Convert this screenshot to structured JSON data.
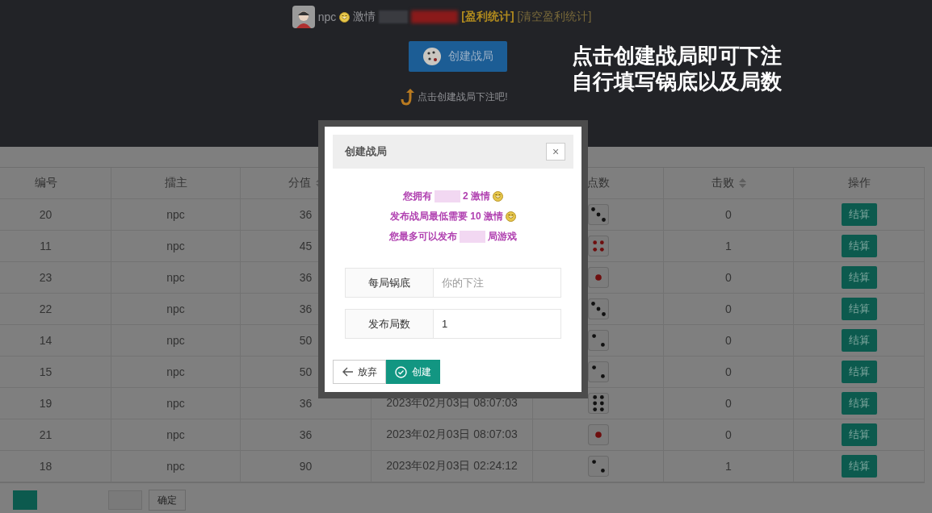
{
  "header": {
    "user": "npc",
    "currency_label": "激情",
    "profit_link": "[盈利统计]",
    "clear_link": "[清空盈利统计]",
    "create_button": "创建战局",
    "hint": "点击创建战局下注吧!"
  },
  "annotation": [
    "点击创建战局即可下注",
    "自行填写锅底以及局数"
  ],
  "table": {
    "columns": [
      {
        "label": "编号",
        "sortable": false
      },
      {
        "label": "擂主",
        "sortable": false
      },
      {
        "label": "分值",
        "sortable": true
      },
      {
        "label": "点数",
        "sortable": false
      },
      {
        "label": "击败",
        "sortable": true
      },
      {
        "label": "操作",
        "sortable": false
      }
    ],
    "rows": [
      {
        "id": "20",
        "host": "npc",
        "score": "36",
        "kind": "three",
        "defeated": "0",
        "action": "结算"
      },
      {
        "id": "11",
        "host": "npc",
        "score": "45",
        "kind": "four",
        "defeated": "1",
        "action": "结算"
      },
      {
        "id": "23",
        "host": "npc",
        "score": "36",
        "kind": "one",
        "defeated": "0",
        "action": "结算"
      },
      {
        "id": "22",
        "host": "npc",
        "score": "36",
        "kind": "three",
        "defeated": "0",
        "action": "结算"
      },
      {
        "id": "14",
        "host": "npc",
        "score": "50",
        "kind": "two",
        "defeated": "0",
        "action": "结算"
      },
      {
        "id": "15",
        "host": "npc",
        "score": "50",
        "kind": "two",
        "defeated": "0",
        "action": "结算"
      },
      {
        "id": "19",
        "host": "npc",
        "score": "36",
        "time": "2023年02月03日 08:07:03",
        "kind": "six",
        "defeated": "0",
        "action": "结算"
      },
      {
        "id": "21",
        "host": "npc",
        "score": "36",
        "time": "2023年02月03日 08:07:03",
        "kind": "one",
        "defeated": "0",
        "action": "结算"
      },
      {
        "id": "18",
        "host": "npc",
        "score": "90",
        "time": "2023年02月03日 02:24:12",
        "kind": "two",
        "defeated": "1",
        "action": "结算"
      }
    ]
  },
  "pager": {
    "confirm": "确定"
  },
  "dialog": {
    "title": "创建战局",
    "close": "×",
    "info": [
      {
        "before": "您拥有",
        "redacted": true,
        "after": "2 激情",
        "coin": true
      },
      {
        "before": "发布战局最低需要 10 激情",
        "redacted": false,
        "coin": true
      },
      {
        "before": "您最多可以发布",
        "redacted": true,
        "after": "局游戏",
        "coin": false
      }
    ],
    "fields": [
      {
        "label": "每局锅底",
        "placeholder": "你的下注"
      },
      {
        "label": "发布局数",
        "value": "1"
      }
    ],
    "buttons": [
      {
        "label": "放弃",
        "kind": "cancel"
      },
      {
        "label": "创建",
        "kind": "confirm"
      }
    ]
  }
}
